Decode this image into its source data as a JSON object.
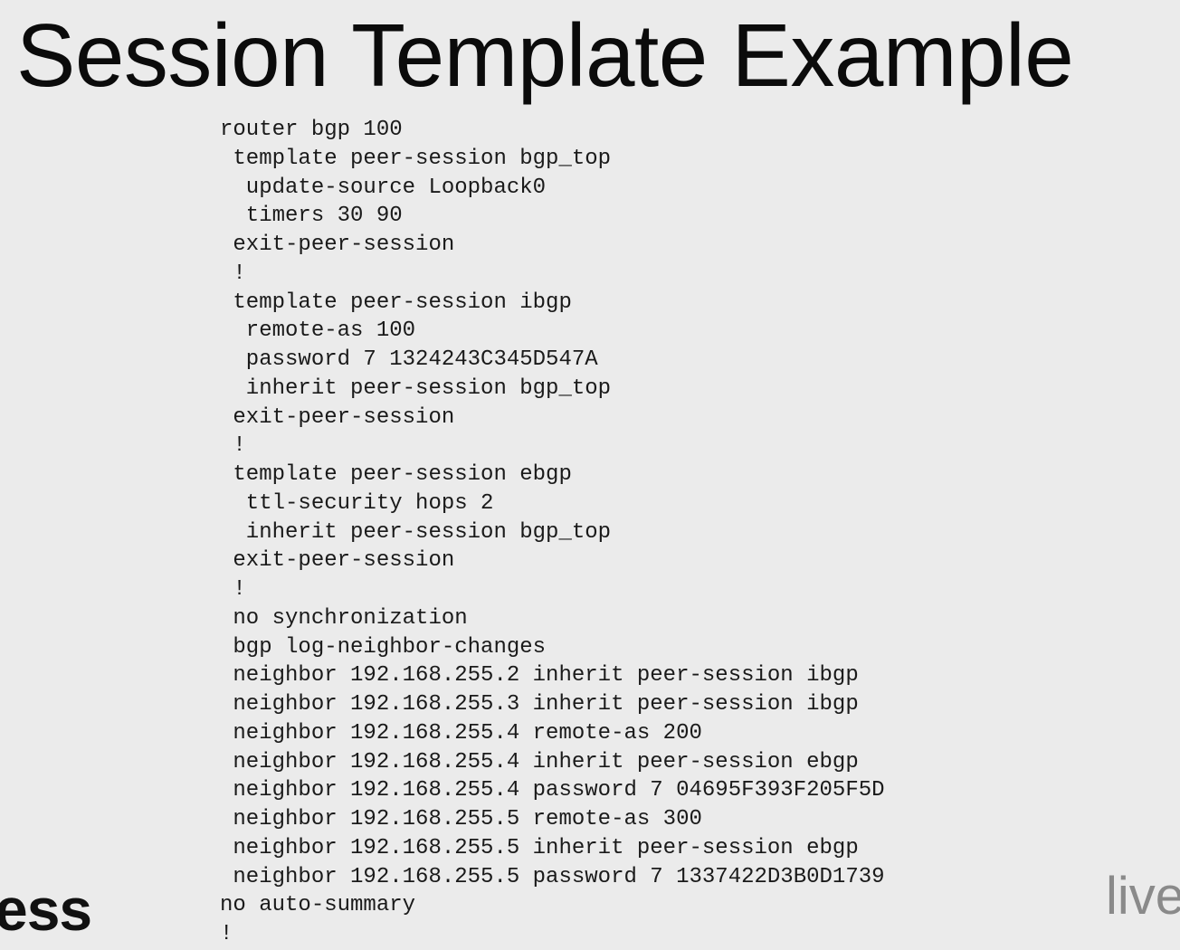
{
  "slide": {
    "title": "Session Template Example",
    "code_lines": [
      "router bgp 100",
      " template peer-session bgp_top",
      "  update-source Loopback0",
      "  timers 30 90",
      " exit-peer-session",
      " !",
      " template peer-session ibgp",
      "  remote-as 100",
      "  password 7 1324243C345D547A",
      "  inherit peer-session bgp_top",
      " exit-peer-session",
      " !",
      " template peer-session ebgp",
      "  ttl-security hops 2",
      "  inherit peer-session bgp_top",
      " exit-peer-session",
      " !",
      " no synchronization",
      " bgp log-neighbor-changes",
      " neighbor 192.168.255.2 inherit peer-session ibgp",
      " neighbor 192.168.255.3 inherit peer-session ibgp",
      " neighbor 192.168.255.4 remote-as 200",
      " neighbor 192.168.255.4 inherit peer-session ebgp",
      " neighbor 192.168.255.4 password 7 04695F393F205F5D",
      " neighbor 192.168.255.5 remote-as 300",
      " neighbor 192.168.255.5 inherit peer-session ebgp",
      " neighbor 192.168.255.5 password 7 1337422D3B0D1739",
      "no auto-summary",
      "!"
    ],
    "logo_left_text": "ess",
    "logo_right_text": "live"
  }
}
